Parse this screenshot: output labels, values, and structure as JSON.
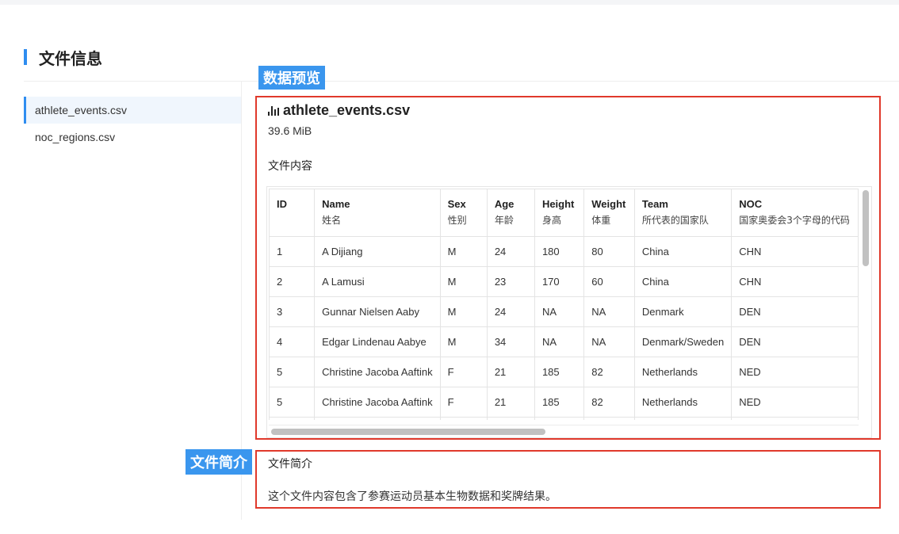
{
  "section": {
    "title": "文件信息"
  },
  "files": [
    {
      "name": "athlete_events.csv",
      "active": true
    },
    {
      "name": "noc_regions.csv",
      "active": false
    }
  ],
  "callouts": {
    "preview": "数据预览",
    "description": "文件简介"
  },
  "preview": {
    "icon": "bar-chart-icon",
    "file_name": "athlete_events.csv",
    "file_size": "39.6 MiB",
    "content_title": "文件内容",
    "columns": [
      {
        "en": "ID",
        "cn": ""
      },
      {
        "en": "Name",
        "cn": "姓名"
      },
      {
        "en": "Sex",
        "cn": "性别"
      },
      {
        "en": "Age",
        "cn": "年龄"
      },
      {
        "en": "Height",
        "cn": "身高"
      },
      {
        "en": "Weight",
        "cn": "体重"
      },
      {
        "en": "Team",
        "cn": "所代表的国家队"
      },
      {
        "en": "NOC",
        "cn": "国家奥委会3个字母的代码"
      }
    ],
    "rows": [
      [
        "1",
        "A Dijiang",
        "M",
        "24",
        "180",
        "80",
        "China",
        "CHN"
      ],
      [
        "2",
        "A Lamusi",
        "M",
        "23",
        "170",
        "60",
        "China",
        "CHN"
      ],
      [
        "3",
        "Gunnar Nielsen Aaby",
        "M",
        "24",
        "NA",
        "NA",
        "Denmark",
        "DEN"
      ],
      [
        "4",
        "Edgar Lindenau Aabye",
        "M",
        "34",
        "NA",
        "NA",
        "Denmark/Sweden",
        "DEN"
      ],
      [
        "5",
        "Christine Jacoba Aaftink",
        "F",
        "21",
        "185",
        "82",
        "Netherlands",
        "NED"
      ],
      [
        "5",
        "Christine Jacoba Aaftink",
        "F",
        "21",
        "185",
        "82",
        "Netherlands",
        "NED"
      ],
      [
        "",
        "",
        "",
        "",
        "",
        "",
        "",
        ""
      ]
    ]
  },
  "description": {
    "title": "文件简介",
    "text": "这个文件内容包含了参赛运动员基本生物数据和奖牌结果。"
  },
  "colors": {
    "accent": "#2f8df0",
    "callout": "#3a96ee",
    "highlight_border": "#e0392b"
  }
}
